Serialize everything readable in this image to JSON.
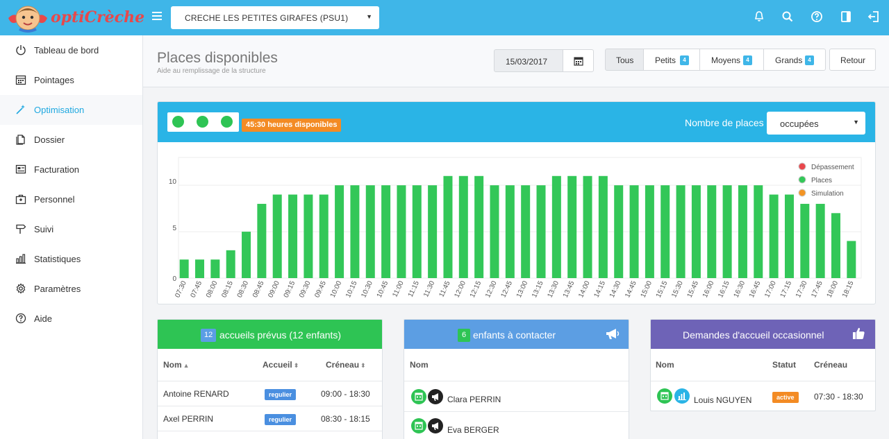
{
  "app": {
    "logo_text": "optiCrèche",
    "creche_selected": "CRECHE LES PETITES GIRAFES (PSU1)"
  },
  "sidebar": {
    "items": [
      {
        "label": "Tableau de bord",
        "icon": "power-icon"
      },
      {
        "label": "Pointages",
        "icon": "calendar-icon"
      },
      {
        "label": "Optimisation",
        "icon": "magic-wand-icon",
        "active": true
      },
      {
        "label": "Dossier",
        "icon": "folder-icon"
      },
      {
        "label": "Facturation",
        "icon": "invoice-icon"
      },
      {
        "label": "Personnel",
        "icon": "briefcase-icon"
      },
      {
        "label": "Suivi",
        "icon": "signpost-icon"
      },
      {
        "label": "Statistiques",
        "icon": "bar-chart-icon"
      },
      {
        "label": "Paramètres",
        "icon": "gear-icon"
      },
      {
        "label": "Aide",
        "icon": "help-icon"
      }
    ]
  },
  "header": {
    "title": "Places disponibles",
    "subtitle": "Aide au remplissage de la structure",
    "date": "15/03/2017",
    "filters": [
      {
        "label": "Tous",
        "active": true
      },
      {
        "label": "Petits",
        "count": "4"
      },
      {
        "label": "Moyens",
        "count": "4"
      },
      {
        "label": "Grands",
        "count": "4"
      }
    ],
    "back_label": "Retour"
  },
  "chart_panel": {
    "hours_available": "45:30 heures disponibles",
    "places_label": "Nombre de places",
    "places_select": "occupées"
  },
  "chart_data": {
    "type": "bar",
    "categories": [
      "07:30",
      "07:45",
      "08:00",
      "08:15",
      "08:30",
      "08:45",
      "09:00",
      "09:15",
      "09:30",
      "09:45",
      "10:00",
      "10:15",
      "10:30",
      "10:45",
      "11:00",
      "11:15",
      "11:30",
      "11:45",
      "12:00",
      "12:15",
      "12:30",
      "12:45",
      "13:00",
      "13:15",
      "13:30",
      "13:45",
      "14:00",
      "14:15",
      "14:30",
      "14:45",
      "15:00",
      "15:15",
      "15:30",
      "15:45",
      "16:00",
      "16:15",
      "16:30",
      "16:45",
      "17:00",
      "17:15",
      "17:30",
      "17:45",
      "18:00",
      "18:15"
    ],
    "series": [
      {
        "name": "Places",
        "color": "#33c758",
        "values": [
          2,
          2,
          2,
          3,
          5,
          8,
          9,
          9,
          9,
          9,
          10,
          10,
          10,
          10,
          10,
          10,
          10,
          11,
          11,
          11,
          10,
          10,
          10,
          10,
          11,
          11,
          11,
          11,
          10,
          10,
          10,
          10,
          10,
          10,
          10,
          10,
          10,
          10,
          9,
          9,
          8,
          8,
          7,
          4
        ]
      }
    ],
    "legend": [
      {
        "name": "Dépassement",
        "color": "#e8474c"
      },
      {
        "name": "Places",
        "color": "#33c758"
      },
      {
        "name": "Simulation",
        "color": "#f39424"
      }
    ],
    "yticks": [
      "0",
      "5",
      "10"
    ],
    "ylim": [
      0,
      13
    ],
    "grid": true,
    "legend_position": "top-right"
  },
  "panels": {
    "accueils": {
      "count": "12",
      "title": "accueils prévus (12 enfants)",
      "columns": [
        "Nom",
        "Accueil",
        "Créneau"
      ],
      "rows": [
        {
          "nom": "Antoine RENARD",
          "accueil": "regulier",
          "creneau": "09:00 - 18:30"
        },
        {
          "nom": "Axel PERRIN",
          "accueil": "regulier",
          "creneau": "08:30 - 18:15"
        }
      ]
    },
    "contacter": {
      "count": "6",
      "title": "enfants à contacter",
      "columns": [
        "Nom"
      ],
      "rows": [
        {
          "nom": "Clara PERRIN"
        },
        {
          "nom": "Eva BERGER"
        }
      ]
    },
    "demandes": {
      "title": "Demandes d'accueil occasionnel",
      "columns": [
        "Nom",
        "Statut",
        "Créneau"
      ],
      "rows": [
        {
          "nom": "Louis NGUYEN",
          "statut": "active",
          "creneau": "07:30 - 18:30"
        }
      ]
    }
  },
  "colors": {
    "topbar": "#3fb6e8",
    "accent": "#1ea8e0",
    "green": "#2ec454",
    "blue_panel": "#5c9ee3",
    "purple_panel": "#6e63b7",
    "orange": "#f38b24"
  }
}
